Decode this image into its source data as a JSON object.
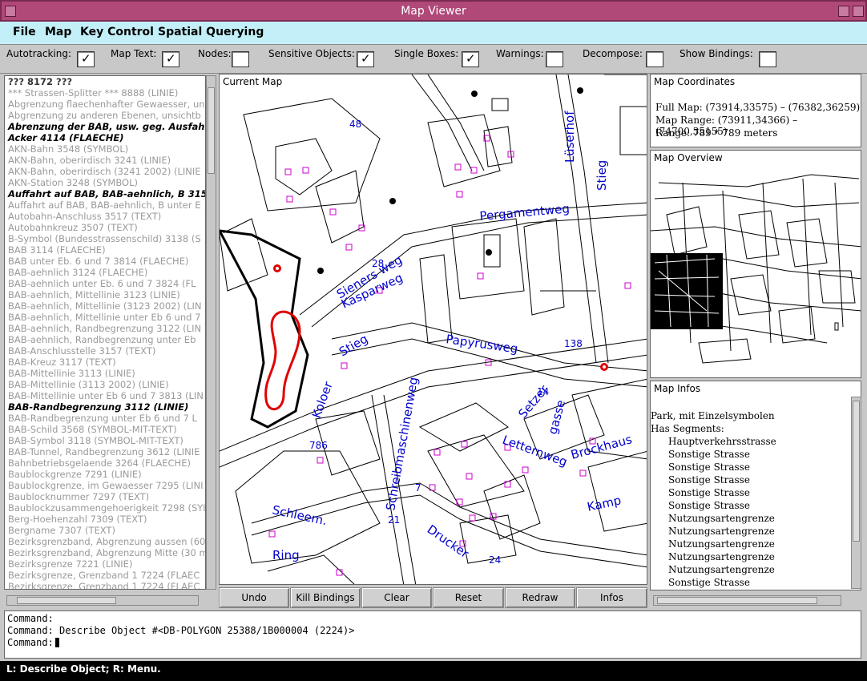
{
  "window": {
    "title": "Map Viewer"
  },
  "menu": [
    {
      "label": "File"
    },
    {
      "label": "Map"
    },
    {
      "label": "Key Control"
    },
    {
      "label": "Spatial Querying"
    }
  ],
  "options": [
    {
      "label": "Autotracking:",
      "checked": true
    },
    {
      "label": "Map Text:",
      "checked": true
    },
    {
      "label": "Nodes:",
      "checked": false
    },
    {
      "label": "Sensitive Objects:",
      "checked": true
    },
    {
      "label": "Single Boxes:",
      "checked": true
    },
    {
      "label": "Warnings:",
      "checked": false
    },
    {
      "label": "Decompose:",
      "checked": false
    },
    {
      "label": "Show Bindings:",
      "checked": false
    }
  ],
  "object_list": [
    {
      "text": "??? 8172 ???",
      "style": "b2"
    },
    {
      "text": "*** Strassen-Splitter *** 8888 (LINIE)",
      "style": "dim"
    },
    {
      "text": "Abgrenzung flaechenhafter Gewaesser, un",
      "style": "dim"
    },
    {
      "text": "Abgrenzung zu anderen Ebenen, unsichtb",
      "style": "dim"
    },
    {
      "text": "Abrenzung der BAB, usw. geg. Ausfahrt, (",
      "style": "bold"
    },
    {
      "text": "Acker 4114 (FLAECHE)",
      "style": "bold"
    },
    {
      "text": "AKN-Bahn 3548 (SYMBOL)",
      "style": "dim"
    },
    {
      "text": "AKN-Bahn, oberirdisch 3241 (LINIE)",
      "style": "dim"
    },
    {
      "text": "AKN-Bahn, oberirdisch (3241 2002) (LINIE",
      "style": "dim"
    },
    {
      "text": "AKN-Station 3248 (SYMBOL)",
      "style": "dim"
    },
    {
      "text": "Auffahrt auf BAB, BAB-aehnlich, B 3152",
      "style": "bold"
    },
    {
      "text": "Auffahrt auf BAB, BAB-aehnlich, B unter E",
      "style": "dim"
    },
    {
      "text": "Autobahn-Anschluss 3517 (TEXT)",
      "style": "dim"
    },
    {
      "text": "Autobahnkreuz 3507 (TEXT)",
      "style": "dim"
    },
    {
      "text": "B-Symbol (Bundesstrassenschild) 3138 (S",
      "style": "dim"
    },
    {
      "text": "BAB 3114 (FLAECHE)",
      "style": "dim"
    },
    {
      "text": "BAB unter Eb. 6 und 7 3814 (FLAECHE)",
      "style": "dim"
    },
    {
      "text": "BAB-aehnlich 3124 (FLAECHE)",
      "style": "dim"
    },
    {
      "text": "BAB-aehnlich unter Eb. 6 und 7 3824 (FL",
      "style": "dim"
    },
    {
      "text": "BAB-aehnlich, Mittellinie 3123 (LINIE)",
      "style": "dim"
    },
    {
      "text": "BAB-aehnlich, Mittellinie (3123 2002) (LIN",
      "style": "dim"
    },
    {
      "text": "BAB-aehnlich, Mittellinie unter Eb 6 und 7",
      "style": "dim"
    },
    {
      "text": "BAB-aehnlich, Randbegrenzung 3122 (LIN",
      "style": "dim"
    },
    {
      "text": "BAB-aehnlich, Randbegrenzung unter Eb",
      "style": "dim"
    },
    {
      "text": "BAB-Anschlusstelle 3157 (TEXT)",
      "style": "dim"
    },
    {
      "text": "BAB-Kreuz 3117 (TEXT)",
      "style": "dim"
    },
    {
      "text": "BAB-Mittellinie 3113 (LINIE)",
      "style": "dim"
    },
    {
      "text": "BAB-Mittellinie (3113 2002) (LINIE)",
      "style": "dim"
    },
    {
      "text": "BAB-Mittellinie unter Eb 6 und 7 3813 (LIN",
      "style": "dim"
    },
    {
      "text": "BAB-Randbegrenzung 3112 (LINIE)",
      "style": "bold"
    },
    {
      "text": "BAB-Randbegrenzung unter Eb 6 und 7 L",
      "style": "dim"
    },
    {
      "text": "BAB-Schild 3568 (SYMBOL-MIT-TEXT)",
      "style": "dim"
    },
    {
      "text": "BAB-Symbol 3118 (SYMBOL-MIT-TEXT)",
      "style": "dim"
    },
    {
      "text": "BAB-Tunnel, Randbegrenzung 3612 (LINIE",
      "style": "dim"
    },
    {
      "text": "Bahnbetriebsgelaende 3264 (FLAECHE)",
      "style": "dim"
    },
    {
      "text": "Baublockgrenze 7291 (LINIE)",
      "style": "dim"
    },
    {
      "text": "Baublockgrenze, im Gewaesser 7295 (LINI",
      "style": "dim"
    },
    {
      "text": "Baublocknummer 7297 (TEXT)",
      "style": "dim"
    },
    {
      "text": "Baublockzusammengehoerigkeit 7298 (SYI",
      "style": "dim"
    },
    {
      "text": "Berg-Hoehenzahl 7309 (TEXT)",
      "style": "dim"
    },
    {
      "text": "Bergname 7307 (TEXT)",
      "style": "dim"
    },
    {
      "text": "Bezirksgrenzband, Abgrenzung aussen (60",
      "style": "dim"
    },
    {
      "text": "Bezirksgrenzband, Abgrenzung Mitte (30 m",
      "style": "dim"
    },
    {
      "text": "Bezirksgrenze 7221 (LINIE)",
      "style": "dim"
    },
    {
      "text": "Bezirksgrenze, Grenzband 1 7224 (FLAEC",
      "style": "dim"
    },
    {
      "text": "Bezirksgrenze, Grenzband 1 7224 (FLAEC",
      "style": "dim"
    }
  ],
  "map": {
    "label": "Current Map",
    "streets": [
      "Pergamentweg",
      "Papyrusweg",
      "Kasparweg",
      "Sieners weg",
      "Stieg",
      "Lüserhof",
      "Stieg",
      "Brockhaus",
      "Letternweg",
      "Drucker",
      "Schleem.",
      "Ring",
      "Setzer",
      "gasse",
      "Kamp",
      "Schreibmaschinenweg",
      "Koloer"
    ],
    "numbers": [
      "48",
      "138",
      "28",
      "786",
      "7",
      "21",
      "24",
      "14"
    ],
    "selection_color": "#e00000",
    "text_color": "#0000cc",
    "symbol_color": "#cc00cc"
  },
  "coords": {
    "label": "Map Coordinates",
    "full_map": "Full Map: (73914,33575) – (76382,36259)",
    "map_range": "Map Range: (73911,34366) – (74700,35155)",
    "range": "Range: 789 * 789 meters"
  },
  "overview": {
    "label": "Map Overview"
  },
  "infos": {
    "label": "Map Infos",
    "title": "Park, mit Einzelsymbolen",
    "has_segments": "Has Segments:",
    "segments": [
      "Hauptverkehrsstrasse",
      "Sonstige Strasse",
      "Sonstige Strasse",
      "Sonstige Strasse",
      "Sonstige Strasse",
      "Sonstige Strasse",
      "Nutzungsartengrenze",
      "Nutzungsartengrenze",
      "Nutzungsartengrenze",
      "Nutzungsartengrenze",
      "Nutzungsartengrenze",
      "Sonstige Strasse"
    ]
  },
  "buttons": [
    {
      "label": "Undo"
    },
    {
      "label": "Kill Bindings"
    },
    {
      "label": "Clear"
    },
    {
      "label": "Reset"
    },
    {
      "label": "Redraw"
    },
    {
      "label": "Infos"
    }
  ],
  "console": {
    "line1": "Command:",
    "line2": "Command: Describe Object #<DB-POLYGON 25388/1B000004 (2224)>",
    "line3": "Command:"
  },
  "status": "L: Describe Object; R: Menu."
}
